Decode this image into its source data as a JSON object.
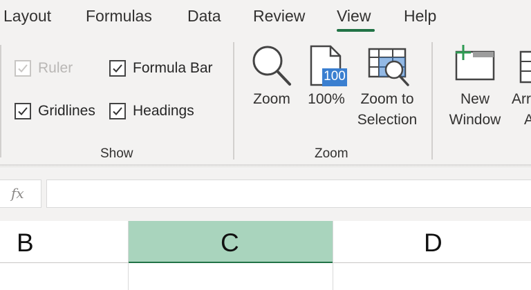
{
  "tabs": [
    {
      "label": "Layout",
      "active": false
    },
    {
      "label": "Formulas",
      "active": false
    },
    {
      "label": "Data",
      "active": false
    },
    {
      "label": "Review",
      "active": false
    },
    {
      "label": "View",
      "active": true
    },
    {
      "label": "Help",
      "active": false
    }
  ],
  "show_group": {
    "label": "Show",
    "ruler": {
      "label": "Ruler",
      "checked": true,
      "enabled": false
    },
    "formula_bar": {
      "label": "Formula Bar",
      "checked": true,
      "enabled": true
    },
    "gridlines": {
      "label": "Gridlines",
      "checked": true,
      "enabled": true
    },
    "headings": {
      "label": "Headings",
      "checked": true,
      "enabled": true
    }
  },
  "zoom_group": {
    "label": "Zoom",
    "zoom": {
      "label": "Zoom",
      "icon": "magnifier-icon"
    },
    "hundred": {
      "label": "100%",
      "badge": "100",
      "icon": "zoom-100-icon"
    },
    "zoom_selection": {
      "label_line1": "Zoom to",
      "label_line2": "Selection",
      "icon": "zoom-to-selection-icon"
    }
  },
  "window_group": {
    "new_window": {
      "label_line1": "New",
      "label_line2": "Window",
      "icon": "new-window-icon"
    },
    "arrange": {
      "label_line1": "Arr",
      "label_line2": "A",
      "icon": "arrange-all-icon"
    }
  },
  "formula_bar": {
    "fx_label": "fx",
    "value": ""
  },
  "columns": [
    {
      "label": "B",
      "selected": false
    },
    {
      "label": "C",
      "selected": true
    },
    {
      "label": "D",
      "selected": false
    }
  ],
  "colors": {
    "accent": "#217346",
    "selected_header": "#a9d4bd",
    "ribbon_bg": "#f3f2f1",
    "badge_blue": "#3a7fd0"
  }
}
